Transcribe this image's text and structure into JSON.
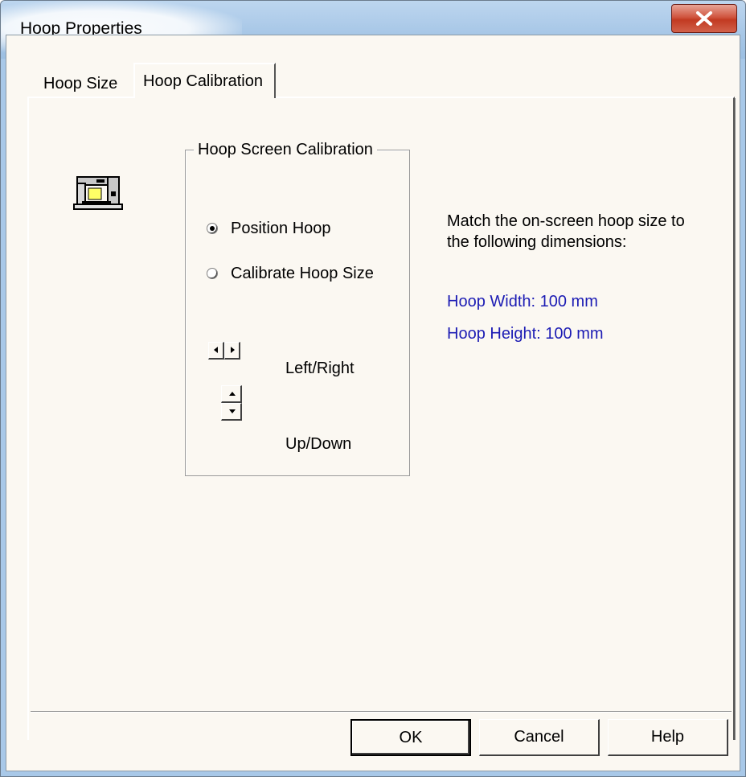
{
  "window": {
    "title": "Hoop Properties"
  },
  "tabs": [
    {
      "label": "Hoop Size",
      "selected": false
    },
    {
      "label": "Hoop Calibration",
      "selected": true
    }
  ],
  "group": {
    "title": "Hoop Screen Calibration",
    "radios": [
      {
        "label": "Position Hoop",
        "checked": true
      },
      {
        "label": "Calibrate Hoop Size",
        "checked": false
      }
    ],
    "left_right_label": "Left/Right",
    "up_down_label": "Up/Down"
  },
  "info": {
    "text": "Match the on-screen hoop size to the following dimensions:",
    "width": "Hoop Width: 100 mm",
    "height": "Hoop Height: 100 mm"
  },
  "buttons": {
    "ok": "OK",
    "cancel": "Cancel",
    "help": "Help"
  },
  "icons": {
    "close": "close-icon",
    "machine": "sewing-machine-icon",
    "left": "arrow-left-icon",
    "right": "arrow-right-icon",
    "up": "arrow-up-icon",
    "down": "arrow-down-icon"
  },
  "colors": {
    "titlebar": "#a6c6e6",
    "client_background": "#fbf8f2",
    "link_text": "#1c1cb4",
    "close_button": "#c23a22"
  }
}
